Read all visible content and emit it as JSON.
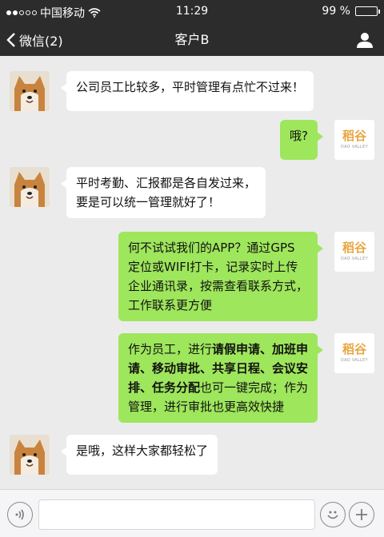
{
  "status_bar": {
    "carrier": "中国移动",
    "time": "11:29",
    "battery_text": "99 %",
    "battery_level": 0.99,
    "icons": [
      "signal-dots-icon",
      "wifi-icon",
      "battery-icon"
    ]
  },
  "nav": {
    "back_label": "微信(2)",
    "title": "客户B",
    "icons": [
      "back-chevron-icon",
      "profile-icon"
    ]
  },
  "company_logo": {
    "main": "稻谷",
    "sub": "DAO VALLEY"
  },
  "messages": [
    {
      "side": "in",
      "text": "公司员工比较多，平时管理有点忙不过来！"
    },
    {
      "side": "out",
      "text": "哦?"
    },
    {
      "side": "in",
      "lines": [
        "平时考勤、汇报都是各自发过来，",
        "要是可以统一管理就好了！"
      ]
    },
    {
      "side": "out",
      "lines": [
        "何不试试我们的APP？通过GPS",
        "定位或WIFI打卡，记录实时上传",
        "企业通讯录，按需查看联系方式，",
        "工作联系更方便"
      ]
    },
    {
      "side": "out",
      "segments": [
        {
          "text": "作为员工，进行",
          "bold": false
        },
        {
          "text": "请假申请、加班申",
          "bold": true
        },
        {
          "text": "请、移动审批、共享日程、会议安",
          "bold": true
        },
        {
          "text": "排、任务分配",
          "bold": true
        },
        {
          "text": "也可一键完成；作为",
          "bold": false
        },
        {
          "text": "管理，进行审批也更高效快捷",
          "bold": false
        }
      ]
    },
    {
      "side": "in",
      "text": "是哦，这样大家都轻松了"
    }
  ],
  "input_bar": {
    "placeholder": "",
    "icons": [
      "voice-icon",
      "emoji-icon",
      "add-icon"
    ]
  },
  "colors": {
    "bar_bg": "#2c2c2c",
    "chat_bg": "#ebebeb",
    "bubble_out": "#9ee65c",
    "bubble_in": "#ffffff",
    "logo": "#e8a640"
  }
}
